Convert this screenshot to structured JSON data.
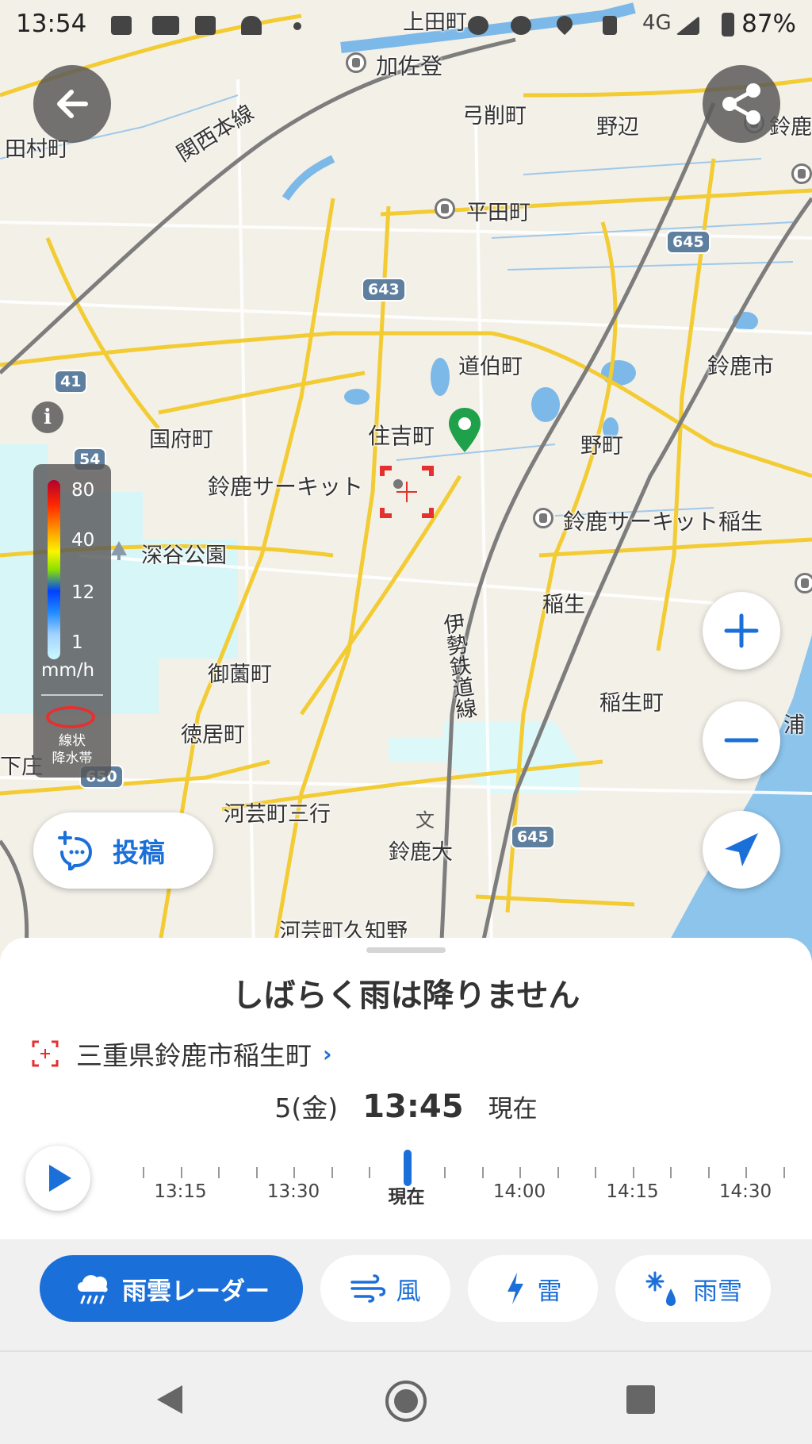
{
  "status_bar": {
    "time": "13:54",
    "network": "4G",
    "battery": "87%"
  },
  "map": {
    "places": [
      {
        "id": "kamitacho",
        "name": "上田町"
      },
      {
        "id": "kasado",
        "name": "加佐登"
      },
      {
        "id": "yumizuri",
        "name": "弓削町"
      },
      {
        "id": "nobe",
        "name": "野辺"
      },
      {
        "id": "suzuka-top",
        "name": "鈴鹿"
      },
      {
        "id": "tamura",
        "name": "田村町"
      },
      {
        "id": "hirata",
        "name": "平田町"
      },
      {
        "id": "dohaku",
        "name": "道伯町"
      },
      {
        "id": "suzuka-city",
        "name": "鈴鹿市"
      },
      {
        "id": "kokufu",
        "name": "国府町"
      },
      {
        "id": "sumiyoshi",
        "name": "住吉町"
      },
      {
        "id": "nocho",
        "name": "野町"
      },
      {
        "id": "circuit",
        "name": "鈴鹿サーキット"
      },
      {
        "id": "circuit-inou",
        "name": "鈴鹿サーキット稲生"
      },
      {
        "id": "fukaya",
        "name": "深谷公園"
      },
      {
        "id": "inou",
        "name": "稲生"
      },
      {
        "id": "misono",
        "name": "御薗町"
      },
      {
        "id": "inoucho",
        "name": "稲生町"
      },
      {
        "id": "tokui",
        "name": "徳居町"
      },
      {
        "id": "shimosho",
        "name": "下庄"
      },
      {
        "id": "kago-sangyo",
        "name": "河芸町三行"
      },
      {
        "id": "suzuka-univ",
        "name": "鈴鹿大"
      },
      {
        "id": "kago-kuchino",
        "name": "河芸町久知野"
      },
      {
        "id": "ura",
        "name": "浦"
      }
    ],
    "rail_lines": [
      {
        "id": "kansai",
        "name": "関西本線"
      },
      {
        "id": "ise",
        "name": "伊勢鉄道線"
      }
    ],
    "route_shields": [
      "643",
      "645",
      "41",
      "54",
      "650",
      "645"
    ]
  },
  "legend": {
    "levels": [
      "80",
      "40",
      "12",
      "1"
    ],
    "unit": "mm/h",
    "line_type": [
      "線状",
      "降水帯"
    ]
  },
  "post_button": {
    "label": "投稿"
  },
  "sheet": {
    "title": "しばらく雨は降りません",
    "location": "三重県鈴鹿市稲生町",
    "day": "5(金)",
    "time": "13:45",
    "now_label": "現在"
  },
  "timeline": {
    "labels": [
      "13:15",
      "13:30",
      "現在",
      "14:00",
      "14:15",
      "14:30"
    ],
    "current_index": 2
  },
  "tabs": [
    {
      "label": "雨雲レーダー",
      "active": true
    },
    {
      "label": "風",
      "active": false
    },
    {
      "label": "雷",
      "active": false
    },
    {
      "label": "雨雪",
      "active": false
    }
  ],
  "colors": {
    "accent": "#1b6fd8",
    "pin": "#1fa04a",
    "target": "#e53030"
  }
}
